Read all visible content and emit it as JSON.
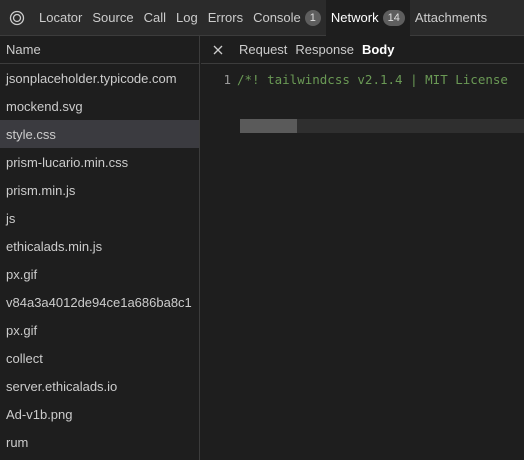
{
  "toolbar": {
    "pick_icon": "target-circle-icon",
    "tabs": [
      {
        "label": "Locator"
      },
      {
        "label": "Source"
      },
      {
        "label": "Call"
      },
      {
        "label": "Log"
      },
      {
        "label": "Errors"
      },
      {
        "label": "Console",
        "badge": "1"
      },
      {
        "label": "Network",
        "badge": "14",
        "active": true
      },
      {
        "label": "Attachments"
      }
    ]
  },
  "requests": {
    "header": "Name",
    "items": [
      "jsonplaceholder.typicode.com",
      "mockend.svg",
      "style.css",
      "prism-lucario.min.css",
      "prism.min.js",
      "js",
      "ethicalads.min.js",
      "px.gif",
      "v84a3a4012de94ce1a686ba8c1",
      "px.gif",
      "collect",
      "server.ethicalads.io",
      "Ad-v1b.png",
      "rum"
    ],
    "selected": "style.css"
  },
  "detail": {
    "close_icon": "close-icon",
    "tabs": [
      "Request",
      "Response",
      "Body"
    ],
    "active_tab": "Body",
    "body": {
      "line_number": "1",
      "text": "/*! tailwindcss v2.1.4 | MIT License"
    },
    "horizontal_scroll_position": 0
  },
  "colors": {
    "background": "#1e1e1e",
    "toolbar": "#2b2b2b",
    "selected_row": "#3b3b40",
    "comment_green": "#6a9955",
    "badge": "#5e5e5e"
  }
}
